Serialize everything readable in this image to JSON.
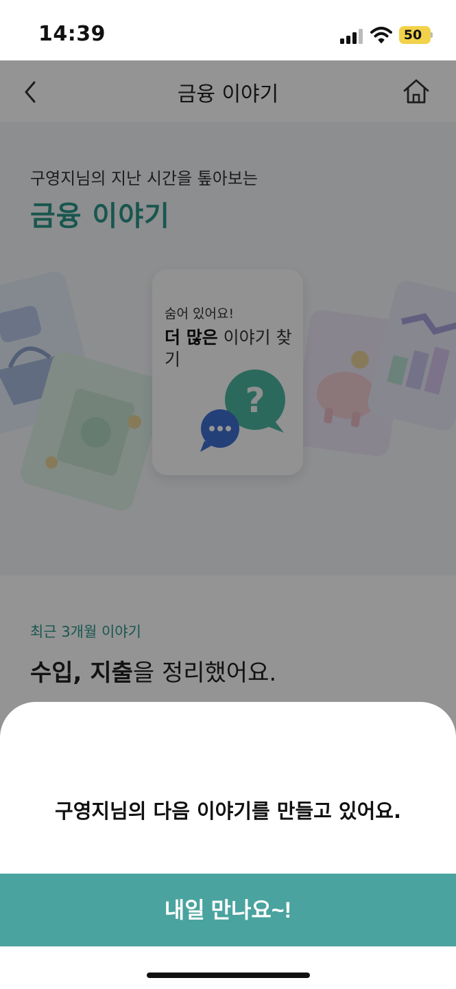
{
  "status_bar": {
    "time": "14:39",
    "battery": "50"
  },
  "nav": {
    "title": "금융 이야기"
  },
  "hero": {
    "subtitle": "구영지님의 지난 시간을 톺아보는",
    "title": "금융 이야기",
    "card": {
      "subtitle": "숨어 있어요!",
      "main_bold": "더 많은",
      "main_rest": " 이야기 찾기"
    }
  },
  "recent": {
    "label": "최근 3개월 이야기",
    "text_bold": "수입, 지출",
    "text_rest": "을 정리했어요."
  },
  "sheet": {
    "message": "구영지님의 다음 이야기를 만들고 있어요.",
    "button_label": "내일 만나요~!"
  },
  "colors": {
    "accent": "#2a9488",
    "button": "#4aa39f",
    "battery": "#f2d24a"
  }
}
